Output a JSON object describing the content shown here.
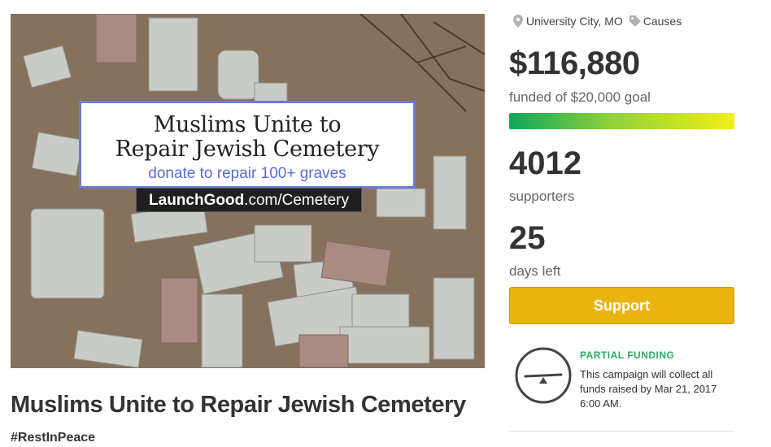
{
  "hero": {
    "banner_line1": "Muslims Unite to",
    "banner_line2": "Repair Jewish Cemetery",
    "banner_sub": "donate to repair 100+ graves",
    "tag_brand": "LaunchGood",
    "tag_rest": ".com/Cemetery"
  },
  "campaign": {
    "title": "Muslims Unite to Repair Jewish Cemetery",
    "hashtag": "#RestInPeace"
  },
  "sidebar": {
    "location": "University City, MO",
    "location_icon": "map-pin-icon",
    "category": "Causes",
    "category_icon": "tag-icon",
    "amount_raised": "$116,880",
    "goal_text": "funded of $20,000 goal",
    "progress_fraction": 1.0,
    "supporters_count": "4012",
    "supporters_label": "supporters",
    "days_left_count": "25",
    "days_left_label": "days left",
    "support_button": "Support",
    "partial_funding": {
      "icon": "balance-scale-icon",
      "title": "PARTIAL FUNDING",
      "text": "This campaign will collect all funds raised by Mar 21, 2017 6:00 AM."
    }
  },
  "colors": {
    "accent_button": "#e9b40d",
    "progress_start": "#0ca85b",
    "progress_end": "#f2ef19",
    "partial_title": "#27ae60"
  }
}
